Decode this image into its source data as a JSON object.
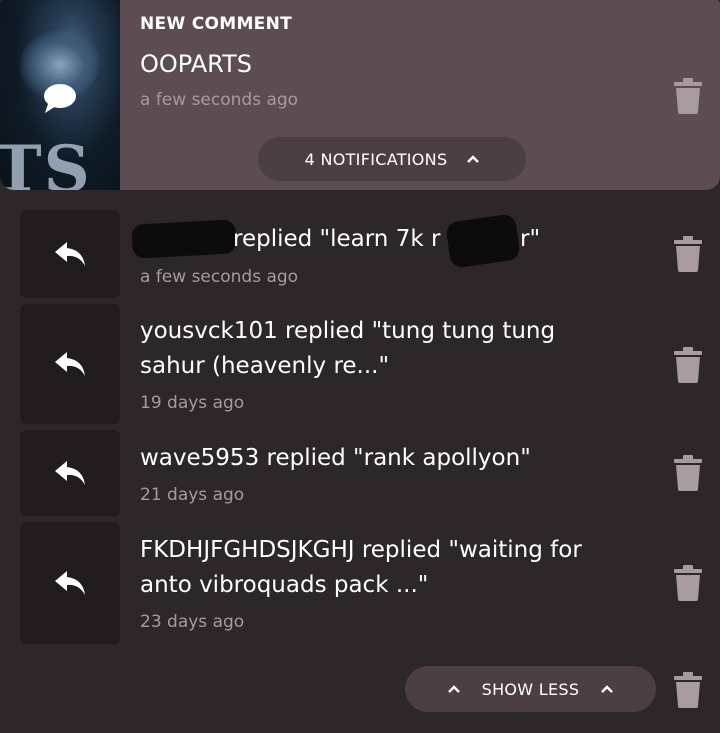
{
  "header": {
    "title": "NEW COMMENT",
    "name": "OOPARTS",
    "time": "a few seconds ago",
    "thumb_letters": "TS",
    "notifications_label": "4 NOTIFICATIONS"
  },
  "notifications": [
    {
      "text": "replied \"learn 7k r",
      "text_tail": "r\"",
      "time": "a few seconds ago"
    },
    {
      "text": "yousvck101 replied \"tung tung tung",
      "text2": "sahur (heavenly re...\"",
      "time": "19 days ago"
    },
    {
      "text": "wave5953 replied \"rank apollyon\"",
      "time": "21 days ago"
    },
    {
      "text": "FKDHJFGHDSJKGHJ replied \"waiting for",
      "text2": "anto vibroquads pack ...\"",
      "time": "23 days ago"
    }
  ],
  "footer": {
    "show_less_label": "SHOW LESS"
  },
  "colors": {
    "background": "#2e2729",
    "header_card": "#5d4d53",
    "pill": "#4c3f44",
    "reply_box": "#231c1f",
    "muted_text": "#a79aa0",
    "icon": "#a79aa0"
  },
  "icons": {
    "comment": "speech-bubble-icon",
    "reply": "reply-arrow-icon",
    "delete": "trash-icon",
    "chevron": "chevron-up-icon"
  }
}
